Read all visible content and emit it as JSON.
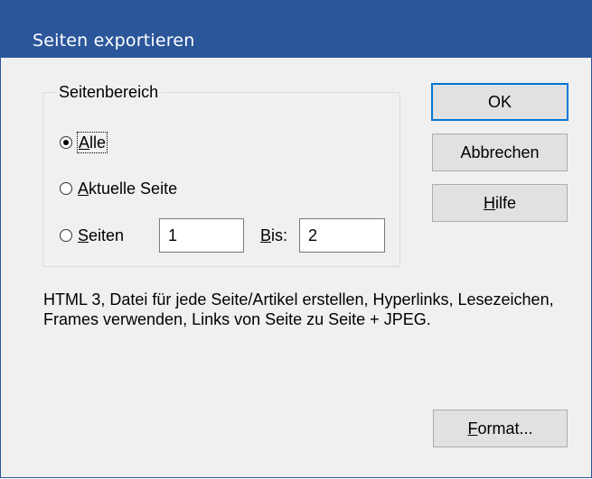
{
  "dialog": {
    "title": "Seiten exportieren"
  },
  "range_group": {
    "legend": "Seitenbereich",
    "options": [
      {
        "id": "all",
        "label": "Alle",
        "mnemonic": "A",
        "rest": "lle",
        "selected": true
      },
      {
        "id": "current",
        "label": "Aktuelle Seite",
        "mnemonic": "A",
        "rest": "ktuelle Seite",
        "selected": false
      },
      {
        "id": "pages",
        "label": "Seiten",
        "mnemonic": "S",
        "rest": "eiten",
        "selected": false
      }
    ],
    "from_value": "1",
    "to_label_mnemonic": "B",
    "to_label_rest": "is:",
    "to_value": "2"
  },
  "buttons": {
    "ok": "OK",
    "cancel": "Abbrechen",
    "help_mnemonic": "H",
    "help_rest": "ilfe",
    "format_mnemonic": "F",
    "format_rest": "ormat..."
  },
  "description": "HTML 3, Datei für jede Seite/Artikel erstellen, Hyperlinks, Lesezeichen, Frames verwenden, Links von Seite zu Seite + JPEG.",
  "colors": {
    "titlebar": "#2b579a",
    "dialog_bg": "#f0f0f0",
    "default_button_border": "#0078d7",
    "button_bg": "#e1e1e1"
  }
}
